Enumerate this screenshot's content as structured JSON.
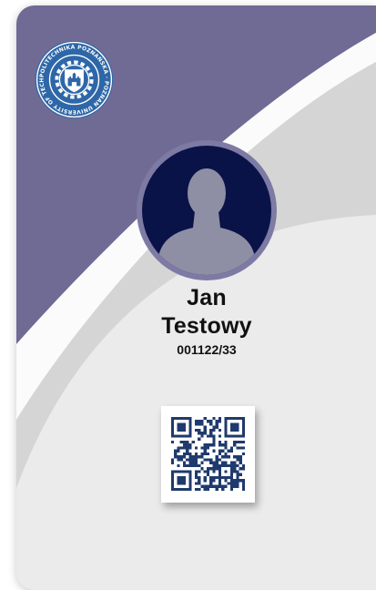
{
  "badge": {
    "logo": {
      "icon": "university-seal-icon",
      "ring_text": "POLITECHNIKA POZNAŃSKA · POZNAN UNIVERSITY OF TECHNOLOGY",
      "color": "#2e67a8"
    },
    "photo": {
      "icon": "person-silhouette-icon"
    },
    "person": {
      "first_name": "Jan",
      "last_name": "Testowy",
      "id_number": "001122/33"
    },
    "qr": {
      "icon": "qr-code-icon"
    },
    "colors": {
      "header_band": "#6f6b94",
      "card_background": "#ebebeb",
      "avatar_circle": "#0a1348",
      "avatar_ring": "#7d7aa4",
      "silhouette": "#8e8fa4"
    }
  }
}
